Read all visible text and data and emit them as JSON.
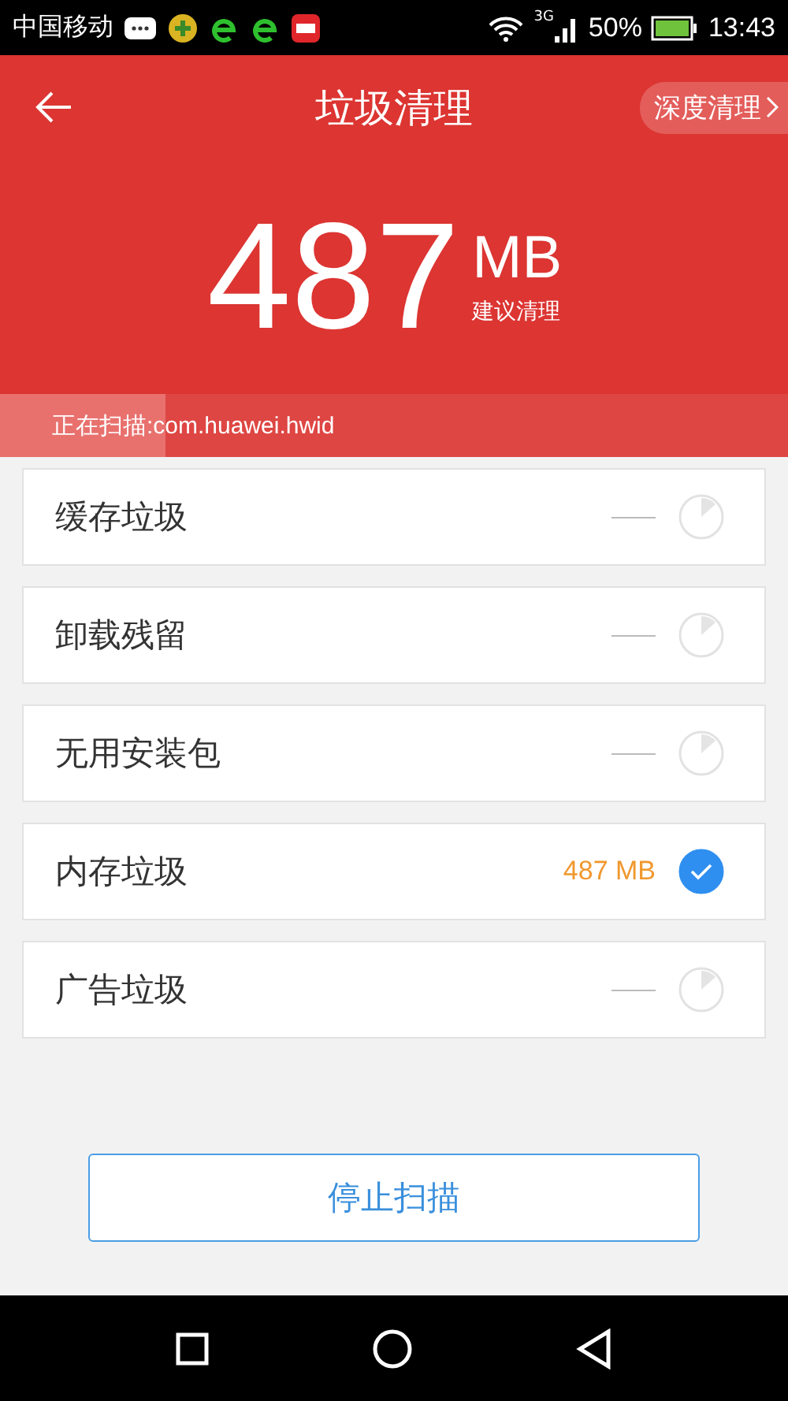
{
  "status_bar": {
    "carrier": "中国移动",
    "network": "3G",
    "battery": "50%",
    "time": "13:43"
  },
  "header": {
    "title": "垃圾清理",
    "action": "深度清理"
  },
  "summary": {
    "amount": "487",
    "unit": "MB",
    "hint": "建议清理"
  },
  "scan": {
    "text": "正在扫描:com.huawei.hwid",
    "level": 0.21
  },
  "items": [
    {
      "label": "缓存垃圾",
      "kind": "scanning"
    },
    {
      "label": "卸载残留",
      "kind": "scanning"
    },
    {
      "label": "无用安装包",
      "kind": "scanning"
    },
    {
      "label": "内存垃圾",
      "kind": "done",
      "size": "487 MB",
      "checked": true
    },
    {
      "label": "广告垃圾",
      "kind": "scanning"
    }
  ],
  "stop_button": "停止扫描"
}
